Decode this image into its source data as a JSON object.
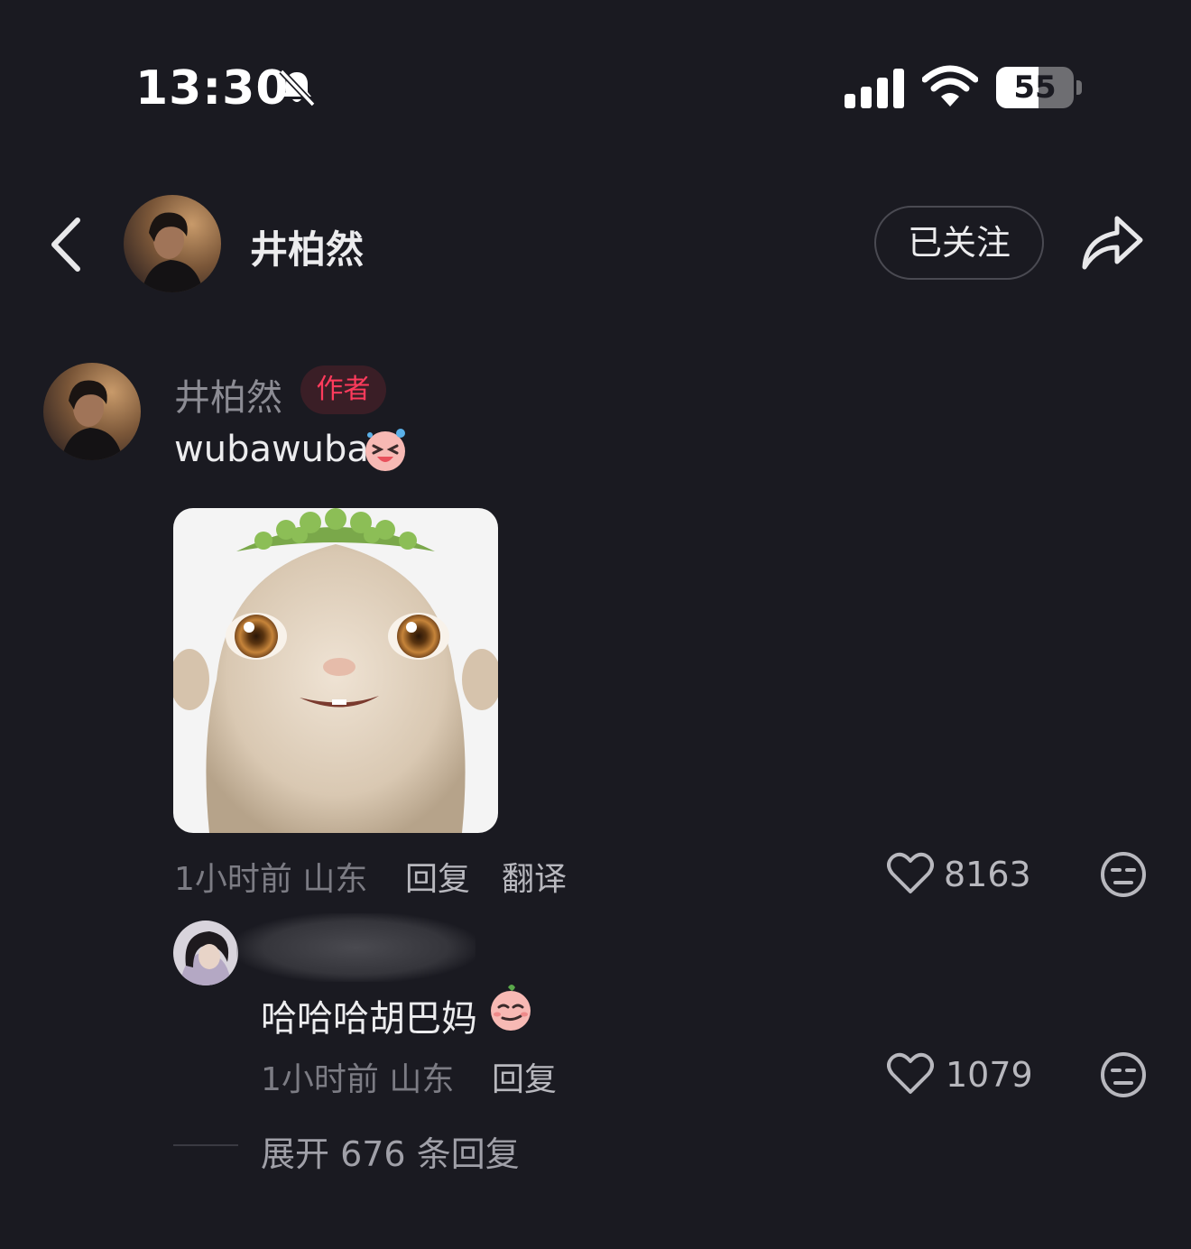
{
  "status_bar": {
    "time": "13:30",
    "battery_level": "55",
    "battery_fraction": 0.55,
    "icons": [
      "bell-muted-icon",
      "cellular-signal-icon",
      "wifi-icon",
      "battery-icon"
    ]
  },
  "header": {
    "back_icon": "chevron-left-icon",
    "name": "井柏然",
    "follow_label": "已关注",
    "share_icon": "share-arrow-icon"
  },
  "comment": {
    "username": "井柏然",
    "author_tag": "作者",
    "text": "wubawuba",
    "emoji": "laughing-emoji-icon",
    "time_location": "1小时前 山东",
    "reply_label": "回复",
    "translate_label": "翻译",
    "likes": "8163",
    "accent": "#ff3b5c"
  },
  "reply": {
    "text": "哈哈哈胡巴妈",
    "emoji": "smirk-emoji-icon",
    "time_location": "1小时前 山东",
    "reply_label": "回复",
    "likes": "1079"
  },
  "expand": {
    "label": "展开 676 条回复"
  }
}
